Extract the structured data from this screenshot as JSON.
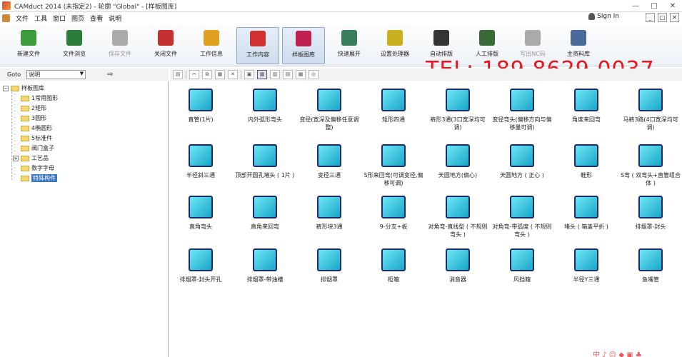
{
  "window": {
    "title": "CAMduct 2014 (未指定2) - 轮廓 \"Global\" - [样板图库]",
    "controls": [
      "—",
      "□",
      "✕"
    ]
  },
  "menu": {
    "items": [
      "文件",
      "工具",
      "窗口",
      "图页",
      "查看",
      "说明"
    ],
    "sign_in": "Sign In",
    "mini_controls": [
      "_",
      "□",
      "✕"
    ]
  },
  "toolbar": {
    "buttons": [
      {
        "label": "新建文件",
        "icon": "new-file-icon",
        "color": "#3c9b3c",
        "disabled": false,
        "active": false
      },
      {
        "label": "文件浏览",
        "icon": "file-browse-icon",
        "color": "#2d7d3a",
        "disabled": false,
        "active": false
      },
      {
        "label": "保存文件",
        "icon": "save-file-icon",
        "color": "#aaaaaa",
        "disabled": true,
        "active": false
      },
      {
        "label": "关闭文件",
        "icon": "close-file-icon",
        "color": "#c53030",
        "disabled": false,
        "active": false
      },
      {
        "label": "工作信息",
        "icon": "info-icon",
        "color": "#e0a020",
        "disabled": false,
        "active": false
      },
      {
        "label": "工作内容",
        "icon": "job-content-icon",
        "color": "#d03030",
        "disabled": false,
        "active": true
      },
      {
        "label": "样板图库",
        "icon": "pattern-library-icon",
        "color": "#c02050",
        "disabled": false,
        "active": true
      },
      {
        "label": "快速展开",
        "icon": "quick-unfold-icon",
        "color": "#3a7d5a",
        "disabled": false,
        "active": false
      },
      {
        "label": "设置处理器",
        "icon": "settings-processor-icon",
        "color": "#c8b020",
        "disabled": false,
        "active": false
      },
      {
        "label": "自动排版",
        "icon": "auto-nest-icon",
        "color": "#333333",
        "disabled": false,
        "active": false
      },
      {
        "label": "人工排版",
        "icon": "manual-nest-icon",
        "color": "#3a6a3a",
        "disabled": false,
        "active": false
      },
      {
        "label": "写出NC码",
        "icon": "write-nc-icon",
        "color": "#aaaaaa",
        "disabled": true,
        "active": false
      },
      {
        "label": "主资料库",
        "icon": "main-database-icon",
        "color": "#4a6a9a",
        "disabled": false,
        "active": false
      }
    ]
  },
  "overlay": {
    "tel": "TEL:  189 8629 0037"
  },
  "goto": {
    "label": "Goto",
    "value": "说明",
    "go_icon": "⇨"
  },
  "right_toolbar": {
    "buttons": [
      "▤",
      "✂",
      "⧉",
      "▦",
      "✕",
      "▣",
      "▦",
      "▥",
      "▤",
      "▦",
      "◎"
    ]
  },
  "tree": {
    "root": "样板图库",
    "items": [
      {
        "label": "1常用图形",
        "expandable": false,
        "selected": false
      },
      {
        "label": "2矩形",
        "expandable": false,
        "selected": false
      },
      {
        "label": "3圆形",
        "expandable": false,
        "selected": false
      },
      {
        "label": "4椭圆形",
        "expandable": false,
        "selected": false
      },
      {
        "label": "5标准件",
        "expandable": false,
        "selected": false
      },
      {
        "label": "阀门盒子",
        "expandable": false,
        "selected": false
      },
      {
        "label": "工艺品",
        "expandable": true,
        "selected": false
      },
      {
        "label": "数字字母",
        "expandable": false,
        "selected": false
      },
      {
        "label": "特殊构件",
        "expandable": false,
        "selected": true
      }
    ]
  },
  "items": [
    [
      "直管(1片)",
      "内外弧形弯头",
      "变径(宽深及偏移任意调整)",
      "矩形四通",
      "裤形3通(3口宽深均可调)",
      "变径弯头(偏移方向与偏移量可调)",
      "角度来回弯",
      "马裤3路(4口宽深均可调)"
    ],
    [
      "半径斜三通",
      "顶部开圆孔堵头 ( 1片 )",
      "变径三通",
      "S形来回弯(可调变径,偏移可调)",
      "天圆地方(偏心)",
      "天圆地方 ( 正心 )",
      "鞋形",
      "S弯 ( 双弯头+直管组合体 )"
    ],
    [
      "直角弯头",
      "直角来回弯",
      "裤形块3通",
      "9-分支+板",
      "对角弯-直线型 ( 不规则弯头 )",
      "对角弯-带弧度 ( 不规则弯头 )",
      "堵头 ( 箱盖平折 )",
      "排烟罩-封头"
    ],
    [
      "排烟罩-封头开孔",
      "排烟罩-带油槽",
      "排烟罩",
      "柜箱",
      "消音器",
      "风挡箱",
      "半径Y三通",
      "鱼嘴管"
    ]
  ],
  "watermark": "中 ♪ ☺ ◆ ▣ ♣"
}
